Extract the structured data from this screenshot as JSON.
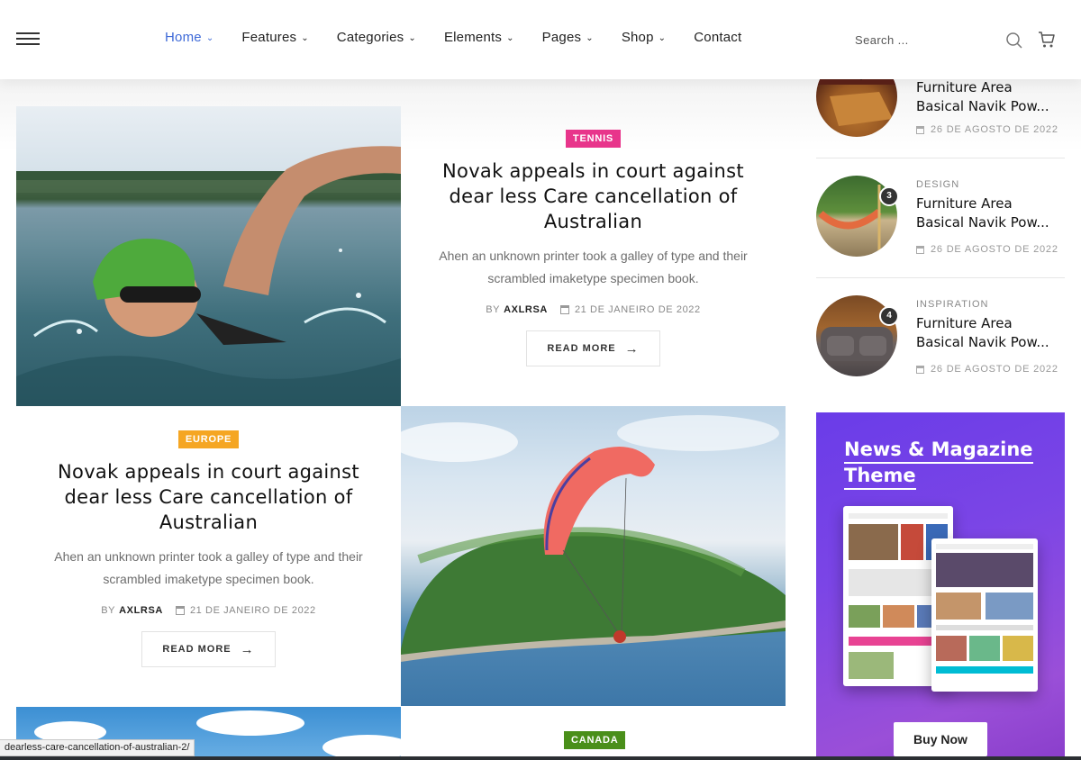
{
  "nav": {
    "items": [
      {
        "label": "Home",
        "active": true
      },
      {
        "label": "Features",
        "active": false
      },
      {
        "label": "Categories",
        "active": false
      },
      {
        "label": "Elements",
        "active": false
      },
      {
        "label": "Pages",
        "active": false
      },
      {
        "label": "Shop",
        "active": false
      },
      {
        "label": "Contact",
        "active": false
      }
    ],
    "search_placeholder": "Search ..."
  },
  "posts": [
    {
      "category": "TENNIS",
      "category_color": "#e8358b",
      "title": "Novak appeals in court against dear less Care cancellation of Australian",
      "excerpt": "Ahen an unknown printer took a galley of type and their scrambled imaketype specimen book.",
      "by_label": "BY",
      "author": "AXLRSA",
      "date": "21 DE JANEIRO DE 2022",
      "read_more": "READ MORE"
    },
    {
      "category": "EUROPE",
      "category_color": "#f5a623",
      "title": "Novak appeals in court against dear less Care cancellation of Australian",
      "excerpt": "Ahen an unknown printer took a galley of type and their scrambled imaketype specimen book.",
      "by_label": "BY",
      "author": "AXLRSA",
      "date": "21 DE JANEIRO DE 2022",
      "read_more": "READ MORE"
    }
  ],
  "canada_badge": {
    "label": "CANADA",
    "color": "#4a8f1a"
  },
  "sidebar": {
    "items": [
      {
        "number": "",
        "category": "",
        "title_line1": "Furniture Area",
        "title_line2": "Basical Navik Pow...",
        "date": "26 DE AGOSTO DE 2022"
      },
      {
        "number": "3",
        "category": "DESIGN",
        "title_line1": "Furniture Area",
        "title_line2": "Basical Navik Pow...",
        "date": "26 DE AGOSTO DE 2022"
      },
      {
        "number": "4",
        "category": "INSPIRATION",
        "title_line1": "Furniture Area",
        "title_line2": "Basical Navik Pow...",
        "date": "26 DE AGOSTO DE 2022"
      }
    ]
  },
  "ad": {
    "title_line1": "News & Magazine",
    "title_line2": "Theme",
    "button": "Buy Now"
  },
  "status_url": "dearless-care-cancellation-of-australian-2/",
  "colors": {
    "accent": "#3f6ad8",
    "ad_purple": "#7b45e6"
  }
}
